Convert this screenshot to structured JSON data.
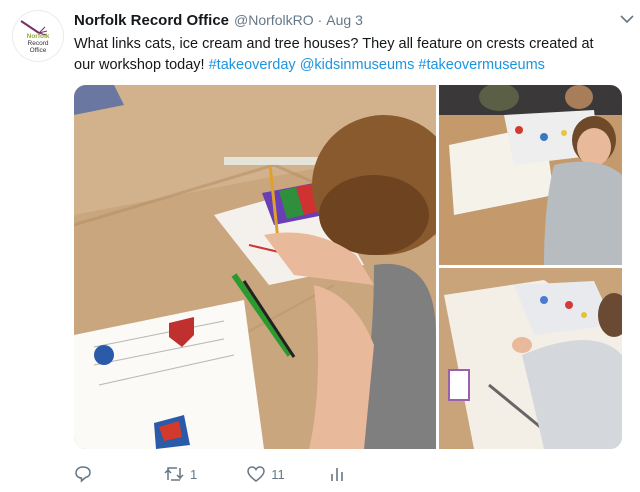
{
  "tweet": {
    "avatar": {
      "org_line1": "Norfolk",
      "org_line2": "Record",
      "org_line3": "Office"
    },
    "display_name": "Norfolk Record Office",
    "handle": "@NorfolkRO",
    "separator": "·",
    "date": "Aug 3",
    "text_plain": "What links cats, ice cream and tree houses? They all feature on crests created at our workshop today!",
    "hashtag1": "#takeoverday",
    "mention": "@kidsinmuseums",
    "hashtag2": "#takeovermuseums",
    "media": {
      "description": "Children drawing crests at a table covered in brown paper"
    },
    "actions": {
      "reply_count": "",
      "retweet_count": "1",
      "like_count": "11"
    }
  },
  "colors": {
    "link": "#1b95e0",
    "secondary_text": "#657786",
    "brand_green": "#8bb13a"
  }
}
